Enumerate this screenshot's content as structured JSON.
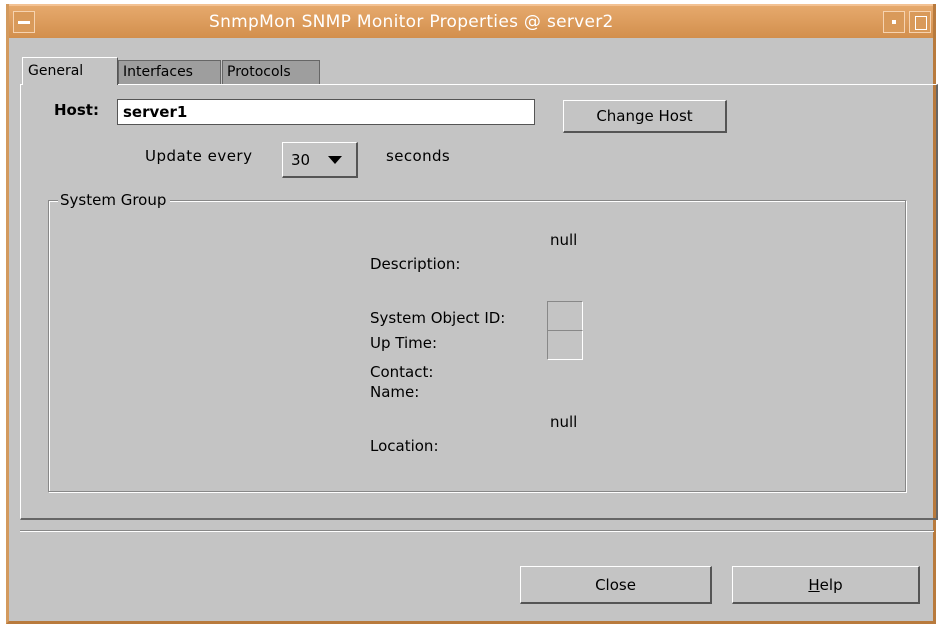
{
  "window": {
    "title": "SnmpMon SNMP Monitor Properties @ server2",
    "accent_color": "#d4914f"
  },
  "tabs": [
    {
      "label": "General",
      "active": true
    },
    {
      "label": "Interfaces",
      "active": false
    },
    {
      "label": "Protocols",
      "active": false
    }
  ],
  "host": {
    "label": "Host:",
    "value": "server1",
    "change_button": "Change Host"
  },
  "update": {
    "prefix": "Update every",
    "interval": "30",
    "suffix": "seconds"
  },
  "system_group": {
    "title": "System Group",
    "description_label": "Description:",
    "description_value": "null",
    "object_id_label": "System Object ID:",
    "uptime_label": "Up Time:",
    "contact_label": "Contact:",
    "name_label": "Name:",
    "location_label": "Location:",
    "location_value": "null"
  },
  "buttons": {
    "close": "Close",
    "help_mnemonic": "H",
    "help_rest": "elp"
  },
  "icons": {
    "window_menu": "window-menu-icon",
    "minimize": "minimize-icon",
    "maximize": "maximize-icon",
    "dropdown": "chevron-down-icon"
  }
}
